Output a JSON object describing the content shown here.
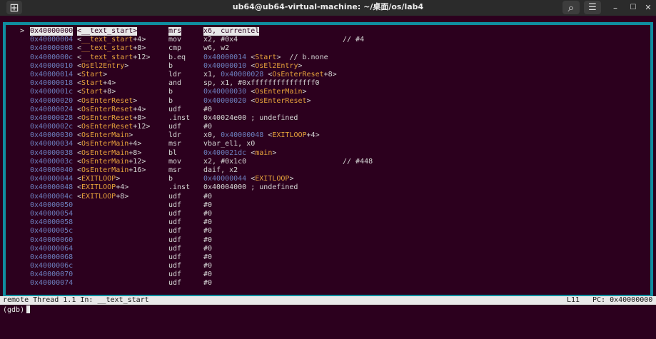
{
  "window": {
    "title": "ub64@ub64-virtual-machine: ~/桌面/os/lab4",
    "new_tab_glyph": "⊞",
    "search_glyph": "⌕",
    "menu_glyph": "☰",
    "minimize_glyph": "–",
    "maximize_glyph": "☐",
    "close_glyph": "✕"
  },
  "colors": {
    "background": "#2c001e",
    "frame_border": "#0f8ea0",
    "address": "#6d7fbf",
    "symbol": "#e8a33c",
    "status_bar": "#e9e9e9"
  },
  "asm_view": {
    "current_marker": ">",
    "lines": [
      {
        "addr": "0x40000000",
        "sym_open": "<",
        "sym_name": "__text_start",
        "sym_off": "",
        "sym_close": ">",
        "mnem": "mrs",
        "ops": [
          {
            "t": "x6, currentel",
            "k": "plain"
          }
        ],
        "comment": "",
        "current": true
      },
      {
        "addr": "0x40000004",
        "sym_open": "<",
        "sym_name": "__text_start",
        "sym_off": "+4",
        "sym_close": ">",
        "mnem": "mov",
        "ops": [
          {
            "t": "x2, #0x4",
            "k": "plain"
          }
        ],
        "comment": "// #4",
        "current": false
      },
      {
        "addr": "0x40000008",
        "sym_open": "<",
        "sym_name": "__text_start",
        "sym_off": "+8",
        "sym_close": ">",
        "mnem": "cmp",
        "ops": [
          {
            "t": "w6, w2",
            "k": "plain"
          }
        ],
        "comment": "",
        "current": false
      },
      {
        "addr": "0x4000000c",
        "sym_open": "<",
        "sym_name": "__text_start",
        "sym_off": "+12",
        "sym_close": ">",
        "mnem": "b.eq",
        "ops": [
          {
            "t": "0x40000014",
            "k": "addr"
          },
          {
            "t": " <",
            "k": "plain"
          },
          {
            "t": "Start",
            "k": "sym"
          },
          {
            "t": ">  // b.none",
            "k": "plain"
          }
        ],
        "comment": "",
        "current": false
      },
      {
        "addr": "0x40000010",
        "sym_open": "<",
        "sym_name": "OsEl2Entry",
        "sym_off": "",
        "sym_close": ">",
        "mnem": "b",
        "ops": [
          {
            "t": "0x40000010",
            "k": "addr"
          },
          {
            "t": " <",
            "k": "plain"
          },
          {
            "t": "OsEl2Entry",
            "k": "sym"
          },
          {
            "t": ">",
            "k": "plain"
          }
        ],
        "comment": "",
        "current": false
      },
      {
        "addr": "0x40000014",
        "sym_open": "<",
        "sym_name": "Start",
        "sym_off": "",
        "sym_close": ">",
        "mnem": "ldr",
        "ops": [
          {
            "t": "x1, ",
            "k": "plain"
          },
          {
            "t": "0x40000028",
            "k": "addr"
          },
          {
            "t": " <",
            "k": "plain"
          },
          {
            "t": "OsEnterReset",
            "k": "sym"
          },
          {
            "t": "+8>",
            "k": "plain"
          }
        ],
        "comment": "",
        "current": false
      },
      {
        "addr": "0x40000018",
        "sym_open": "<",
        "sym_name": "Start",
        "sym_off": "+4",
        "sym_close": ">",
        "mnem": "and",
        "ops": [
          {
            "t": "sp, x1, #0xfffffffffffffff0",
            "k": "plain"
          }
        ],
        "comment": "",
        "current": false
      },
      {
        "addr": "0x4000001c",
        "sym_open": "<",
        "sym_name": "Start",
        "sym_off": "+8",
        "sym_close": ">",
        "mnem": "b",
        "ops": [
          {
            "t": "0x40000030",
            "k": "addr"
          },
          {
            "t": " <",
            "k": "plain"
          },
          {
            "t": "OsEnterMain",
            "k": "sym"
          },
          {
            "t": ">",
            "k": "plain"
          }
        ],
        "comment": "",
        "current": false
      },
      {
        "addr": "0x40000020",
        "sym_open": "<",
        "sym_name": "OsEnterReset",
        "sym_off": "",
        "sym_close": ">",
        "mnem": "b",
        "ops": [
          {
            "t": "0x40000020",
            "k": "addr"
          },
          {
            "t": " <",
            "k": "plain"
          },
          {
            "t": "OsEnterReset",
            "k": "sym"
          },
          {
            "t": ">",
            "k": "plain"
          }
        ],
        "comment": "",
        "current": false
      },
      {
        "addr": "0x40000024",
        "sym_open": "<",
        "sym_name": "OsEnterReset",
        "sym_off": "+4",
        "sym_close": ">",
        "mnem": "udf",
        "ops": [
          {
            "t": "#0",
            "k": "plain"
          }
        ],
        "comment": "",
        "current": false
      },
      {
        "addr": "0x40000028",
        "sym_open": "<",
        "sym_name": "OsEnterReset",
        "sym_off": "+8",
        "sym_close": ">",
        "mnem": ".inst",
        "ops": [
          {
            "t": "0x40024e00 ; undefined",
            "k": "plain"
          }
        ],
        "comment": "",
        "current": false
      },
      {
        "addr": "0x4000002c",
        "sym_open": "<",
        "sym_name": "OsEnterReset",
        "sym_off": "+12",
        "sym_close": ">",
        "mnem": "udf",
        "ops": [
          {
            "t": "#0",
            "k": "plain"
          }
        ],
        "comment": "",
        "current": false
      },
      {
        "addr": "0x40000030",
        "sym_open": "<",
        "sym_name": "OsEnterMain",
        "sym_off": "",
        "sym_close": ">",
        "mnem": "ldr",
        "ops": [
          {
            "t": "x0, ",
            "k": "plain"
          },
          {
            "t": "0x40000048",
            "k": "addr"
          },
          {
            "t": " <",
            "k": "plain"
          },
          {
            "t": "EXITLOOP",
            "k": "sym"
          },
          {
            "t": "+4>",
            "k": "plain"
          }
        ],
        "comment": "",
        "current": false
      },
      {
        "addr": "0x40000034",
        "sym_open": "<",
        "sym_name": "OsEnterMain",
        "sym_off": "+4",
        "sym_close": ">",
        "mnem": "msr",
        "ops": [
          {
            "t": "vbar_el1, x0",
            "k": "plain"
          }
        ],
        "comment": "",
        "current": false
      },
      {
        "addr": "0x40000038",
        "sym_open": "<",
        "sym_name": "OsEnterMain",
        "sym_off": "+8",
        "sym_close": ">",
        "mnem": "bl",
        "ops": [
          {
            "t": "0x400021dc",
            "k": "addr"
          },
          {
            "t": " <",
            "k": "plain"
          },
          {
            "t": "main",
            "k": "sym"
          },
          {
            "t": ">",
            "k": "plain"
          }
        ],
        "comment": "",
        "current": false
      },
      {
        "addr": "0x4000003c",
        "sym_open": "<",
        "sym_name": "OsEnterMain",
        "sym_off": "+12",
        "sym_close": ">",
        "mnem": "mov",
        "ops": [
          {
            "t": "x2, #0x1c0",
            "k": "plain"
          }
        ],
        "comment": "// #448",
        "current": false
      },
      {
        "addr": "0x40000040",
        "sym_open": "<",
        "sym_name": "OsEnterMain",
        "sym_off": "+16",
        "sym_close": ">",
        "mnem": "msr",
        "ops": [
          {
            "t": "daif, x2",
            "k": "plain"
          }
        ],
        "comment": "",
        "current": false
      },
      {
        "addr": "0x40000044",
        "sym_open": "<",
        "sym_name": "EXITLOOP",
        "sym_off": "",
        "sym_close": ">",
        "mnem": "b",
        "ops": [
          {
            "t": "0x40000044",
            "k": "addr"
          },
          {
            "t": " <",
            "k": "plain"
          },
          {
            "t": "EXITLOOP",
            "k": "sym"
          },
          {
            "t": ">",
            "k": "plain"
          }
        ],
        "comment": "",
        "current": false
      },
      {
        "addr": "0x40000048",
        "sym_open": "<",
        "sym_name": "EXITLOOP",
        "sym_off": "+4",
        "sym_close": ">",
        "mnem": ".inst",
        "ops": [
          {
            "t": "0x40004000 ; undefined",
            "k": "plain"
          }
        ],
        "comment": "",
        "current": false
      },
      {
        "addr": "0x4000004c",
        "sym_open": "<",
        "sym_name": "EXITLOOP",
        "sym_off": "+8",
        "sym_close": ">",
        "mnem": "udf",
        "ops": [
          {
            "t": "#0",
            "k": "plain"
          }
        ],
        "comment": "",
        "current": false
      },
      {
        "addr": "0x40000050",
        "sym_open": "",
        "sym_name": "",
        "sym_off": "",
        "sym_close": "",
        "mnem": "udf",
        "ops": [
          {
            "t": "#0",
            "k": "plain"
          }
        ],
        "comment": "",
        "current": false
      },
      {
        "addr": "0x40000054",
        "sym_open": "",
        "sym_name": "",
        "sym_off": "",
        "sym_close": "",
        "mnem": "udf",
        "ops": [
          {
            "t": "#0",
            "k": "plain"
          }
        ],
        "comment": "",
        "current": false
      },
      {
        "addr": "0x40000058",
        "sym_open": "",
        "sym_name": "",
        "sym_off": "",
        "sym_close": "",
        "mnem": "udf",
        "ops": [
          {
            "t": "#0",
            "k": "plain"
          }
        ],
        "comment": "",
        "current": false
      },
      {
        "addr": "0x4000005c",
        "sym_open": "",
        "sym_name": "",
        "sym_off": "",
        "sym_close": "",
        "mnem": "udf",
        "ops": [
          {
            "t": "#0",
            "k": "plain"
          }
        ],
        "comment": "",
        "current": false
      },
      {
        "addr": "0x40000060",
        "sym_open": "",
        "sym_name": "",
        "sym_off": "",
        "sym_close": "",
        "mnem": "udf",
        "ops": [
          {
            "t": "#0",
            "k": "plain"
          }
        ],
        "comment": "",
        "current": false
      },
      {
        "addr": "0x40000064",
        "sym_open": "",
        "sym_name": "",
        "sym_off": "",
        "sym_close": "",
        "mnem": "udf",
        "ops": [
          {
            "t": "#0",
            "k": "plain"
          }
        ],
        "comment": "",
        "current": false
      },
      {
        "addr": "0x40000068",
        "sym_open": "",
        "sym_name": "",
        "sym_off": "",
        "sym_close": "",
        "mnem": "udf",
        "ops": [
          {
            "t": "#0",
            "k": "plain"
          }
        ],
        "comment": "",
        "current": false
      },
      {
        "addr": "0x4000006c",
        "sym_open": "",
        "sym_name": "",
        "sym_off": "",
        "sym_close": "",
        "mnem": "udf",
        "ops": [
          {
            "t": "#0",
            "k": "plain"
          }
        ],
        "comment": "",
        "current": false
      },
      {
        "addr": "0x40000070",
        "sym_open": "",
        "sym_name": "",
        "sym_off": "",
        "sym_close": "",
        "mnem": "udf",
        "ops": [
          {
            "t": "#0",
            "k": "plain"
          }
        ],
        "comment": "",
        "current": false
      },
      {
        "addr": "0x40000074",
        "sym_open": "",
        "sym_name": "",
        "sym_off": "",
        "sym_close": "",
        "mnem": "udf",
        "ops": [
          {
            "t": "#0",
            "k": "plain"
          }
        ],
        "comment": "",
        "current": false
      }
    ]
  },
  "status_bar": {
    "left": "remote Thread 1.1 In: __text_start",
    "line": "L11",
    "pc": "PC: 0x40000000"
  },
  "prompt": {
    "text": "(gdb)"
  }
}
